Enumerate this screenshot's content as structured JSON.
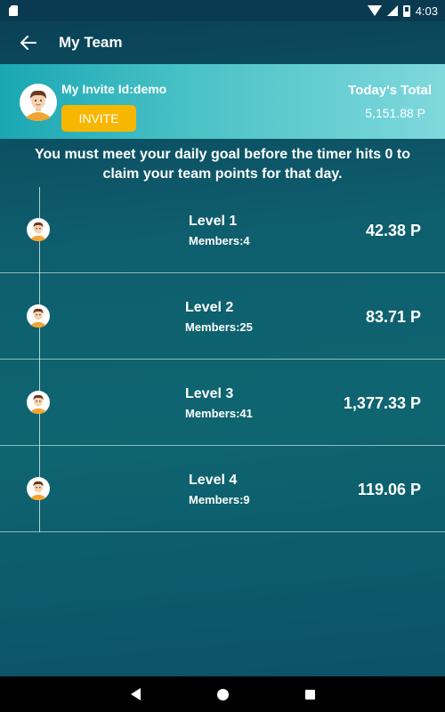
{
  "status_bar": {
    "time": "4:03"
  },
  "app_bar": {
    "title": "My Team"
  },
  "header": {
    "invite_id": "My Invite Id:demo",
    "invite_button_label": "INVITE",
    "total_label": "Today's Total",
    "total_value": "5,151.88 P"
  },
  "goal_message": "You must meet your daily goal before the timer hits 0 to claim your team points for that day.",
  "levels": [
    {
      "name": "Level 1",
      "members": "Members:4",
      "points": "42.38 P"
    },
    {
      "name": "Level 2",
      "members": "Members:25",
      "points": "83.71 P"
    },
    {
      "name": "Level 3",
      "members": "Members:41",
      "points": "1,377.33 P"
    },
    {
      "name": "Level 4",
      "members": "Members:9",
      "points": "119.06 P"
    }
  ],
  "colors": {
    "accent_button": "#f7b600",
    "header_gradient_start": "#1aa7b3",
    "header_gradient_end": "#7fd8dc",
    "background": "#0e5f6e"
  },
  "icons": {
    "back": "arrow-left-icon",
    "avatar": "user-avatar-icon",
    "nav": [
      "nav-back-icon",
      "nav-home-icon",
      "nav-recent-icon"
    ]
  }
}
